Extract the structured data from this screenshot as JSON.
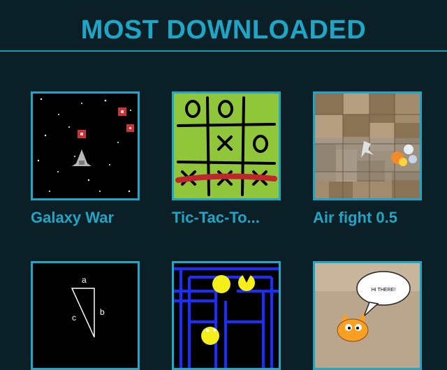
{
  "header": {
    "title": "MOST DOWNLOADED"
  },
  "games": [
    {
      "title": "Galaxy War",
      "icon": "space-shooter-thumbnail"
    },
    {
      "title": "Tic-Tac-To...",
      "icon": "tic-tac-toe-thumbnail"
    },
    {
      "title": "Air fight 0.5",
      "icon": "air-fight-thumbnail"
    },
    {
      "title": "",
      "icon": "triangle-geometry-thumbnail",
      "labels": [
        "a",
        "b",
        "c"
      ]
    },
    {
      "title": "",
      "icon": "maze-game-thumbnail"
    },
    {
      "title": "",
      "icon": "scratch-cat-thumbnail",
      "speech": "HI THERE!"
    }
  ],
  "colors": {
    "accent": "#1fa6c6",
    "background": "#0a1f26"
  }
}
